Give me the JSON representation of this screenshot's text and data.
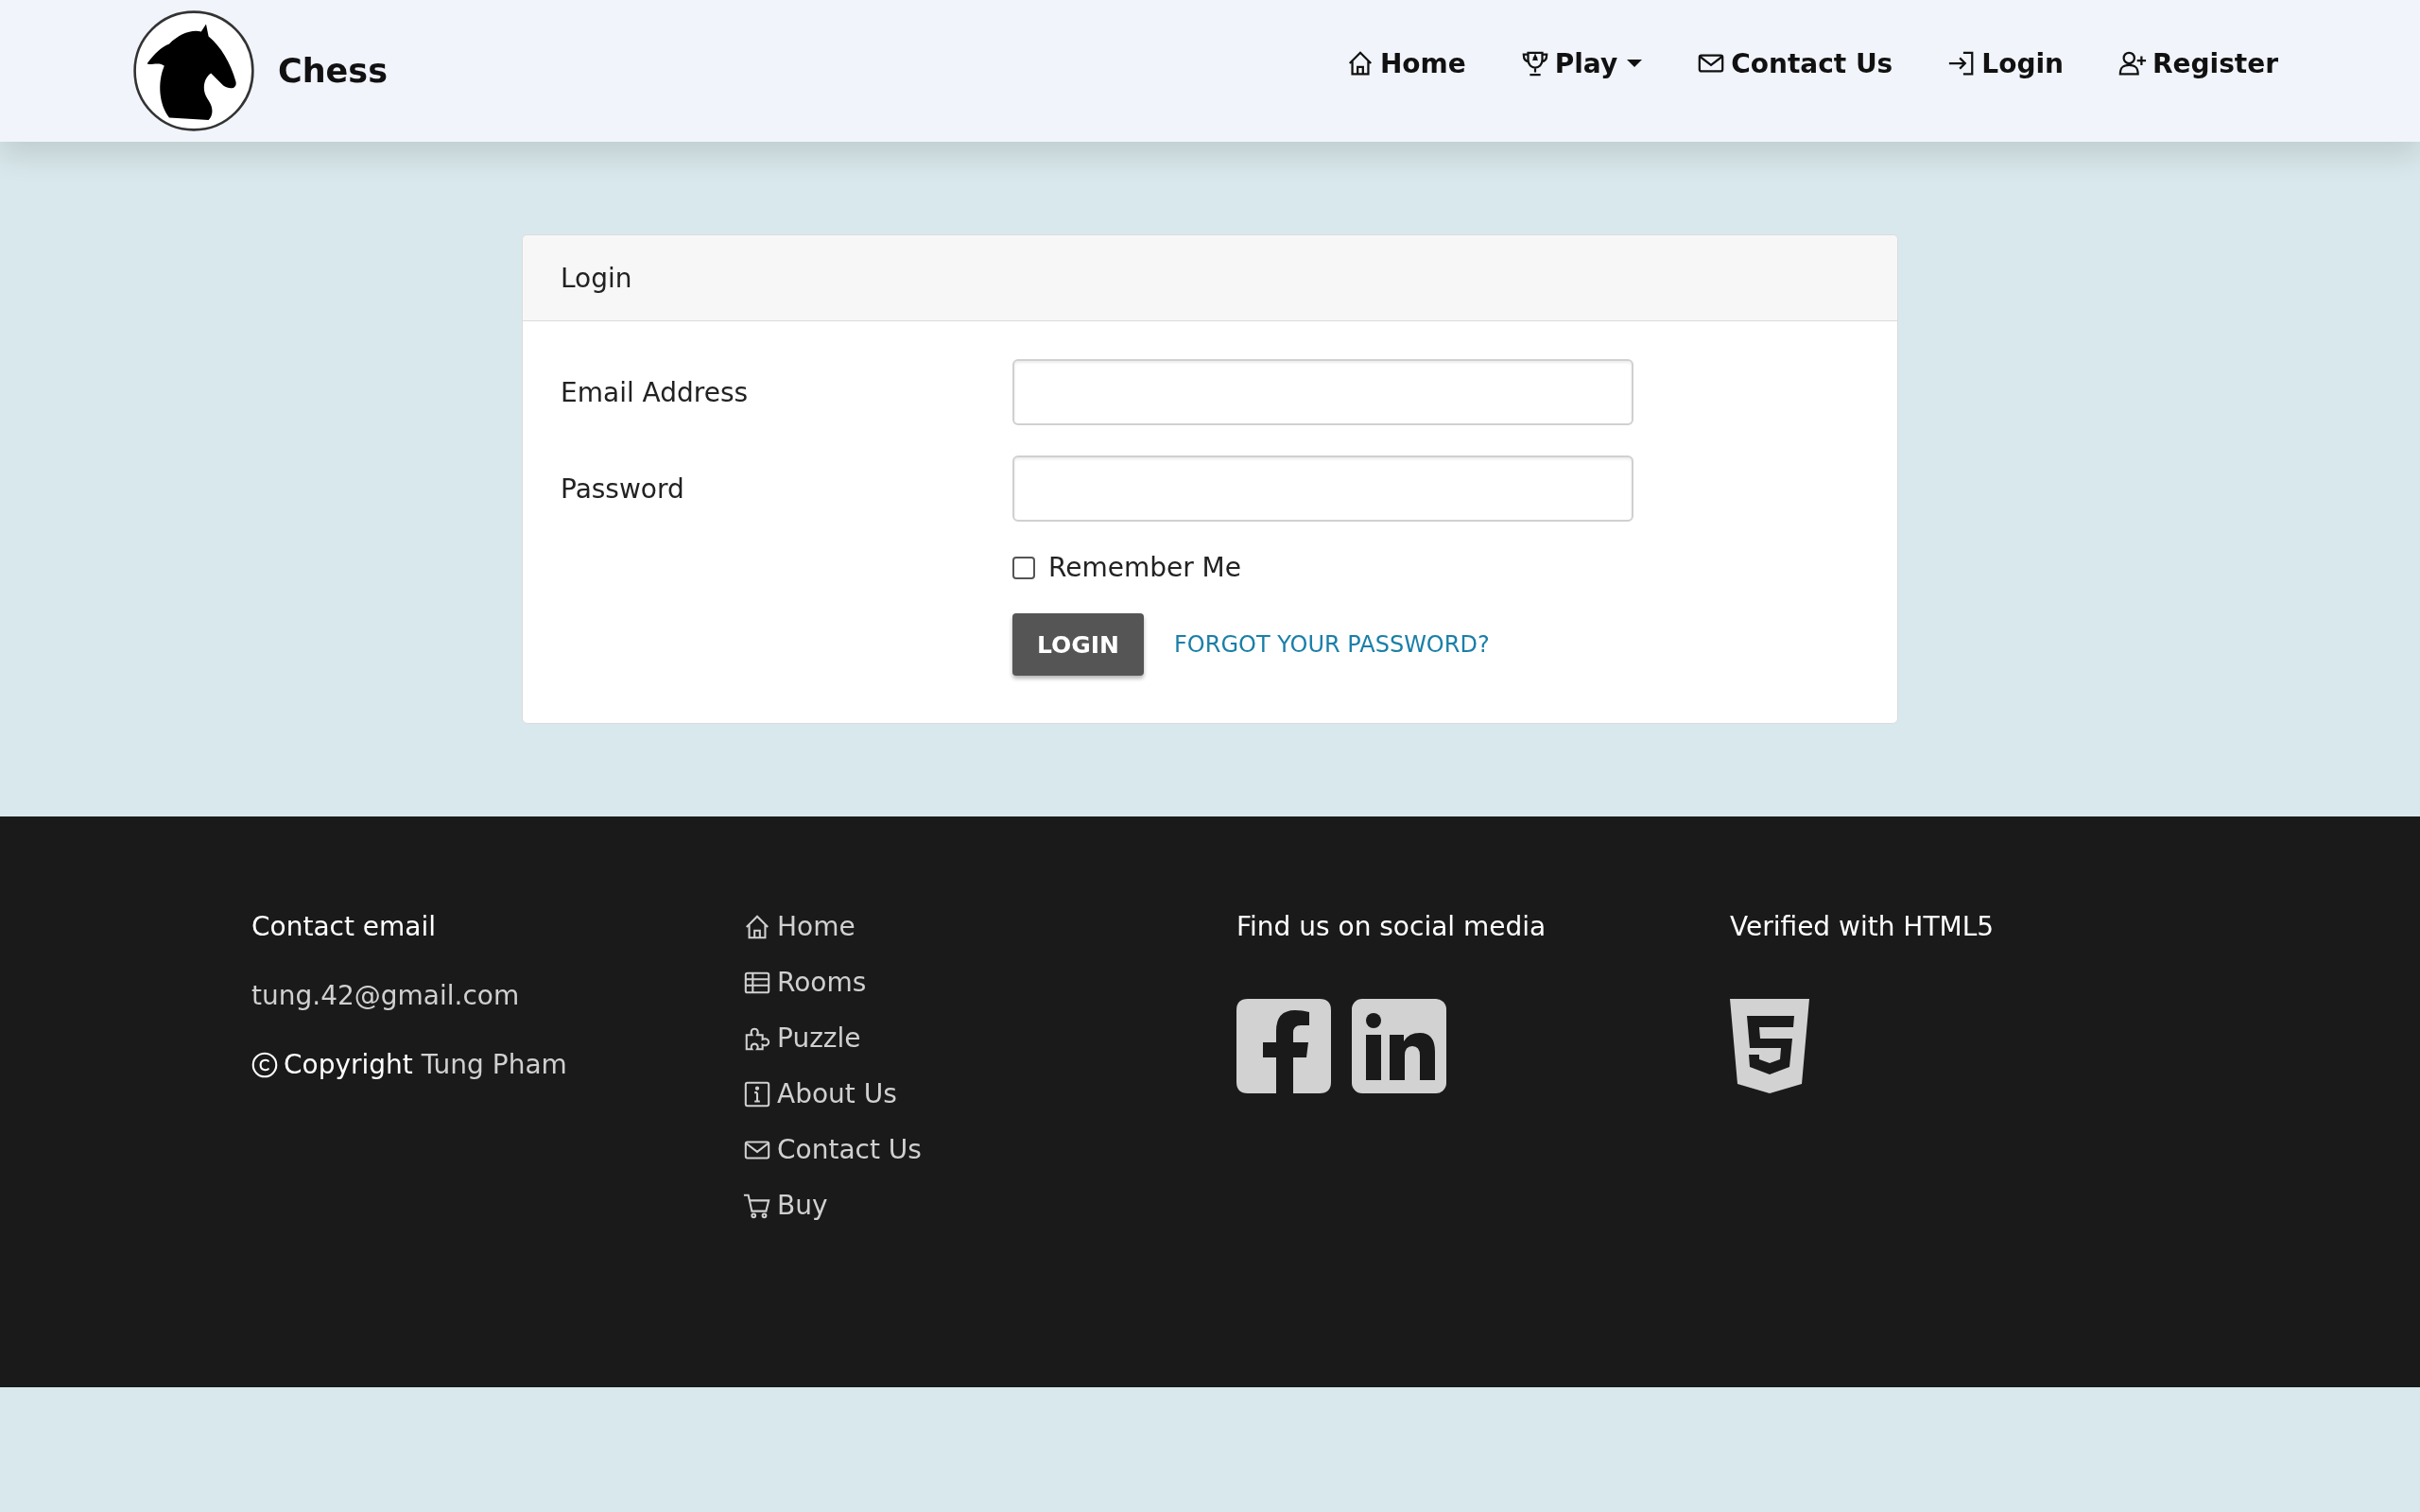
{
  "header": {
    "brand": "Chess",
    "nav": [
      {
        "kind": "home",
        "label": "Home",
        "dropdown": false
      },
      {
        "kind": "trophy",
        "label": "Play",
        "dropdown": true
      },
      {
        "kind": "mail",
        "label": "Contact Us",
        "dropdown": false
      },
      {
        "kind": "login",
        "label": "Login",
        "dropdown": false
      },
      {
        "kind": "register",
        "label": "Register",
        "dropdown": false
      }
    ]
  },
  "login_card": {
    "title": "Login",
    "fields": [
      {
        "label": "Email Address"
      },
      {
        "label": "Password"
      }
    ],
    "remember": {
      "label": "Remember Me",
      "checked": false
    },
    "submit": "LOGIN",
    "forgot_link": "FORGOT YOUR PASSWORD?"
  },
  "footer": {
    "contact": {
      "heading": "Contact email",
      "email": "tung.42@gmail.com",
      "copyright": "**Copyright** Tung Pham"
    },
    "links": [
      {
        "kind": "home",
        "label": "Home"
      },
      {
        "kind": "table",
        "label": "Rooms"
      },
      {
        "kind": "puzzle",
        "label": "Puzzle"
      },
      {
        "kind": "info",
        "label": "About Us"
      },
      {
        "kind": "mail",
        "label": "Contact Us"
      },
      {
        "kind": "cart",
        "label": "Buy"
      }
    ],
    "social": {
      "heading": "Find us on social media",
      "icons": [
        {
          "kind": "facebook"
        },
        {
          "kind": "linkedin"
        }
      ]
    },
    "verified": {
      "heading": "Verified with HTML5"
    }
  }
}
